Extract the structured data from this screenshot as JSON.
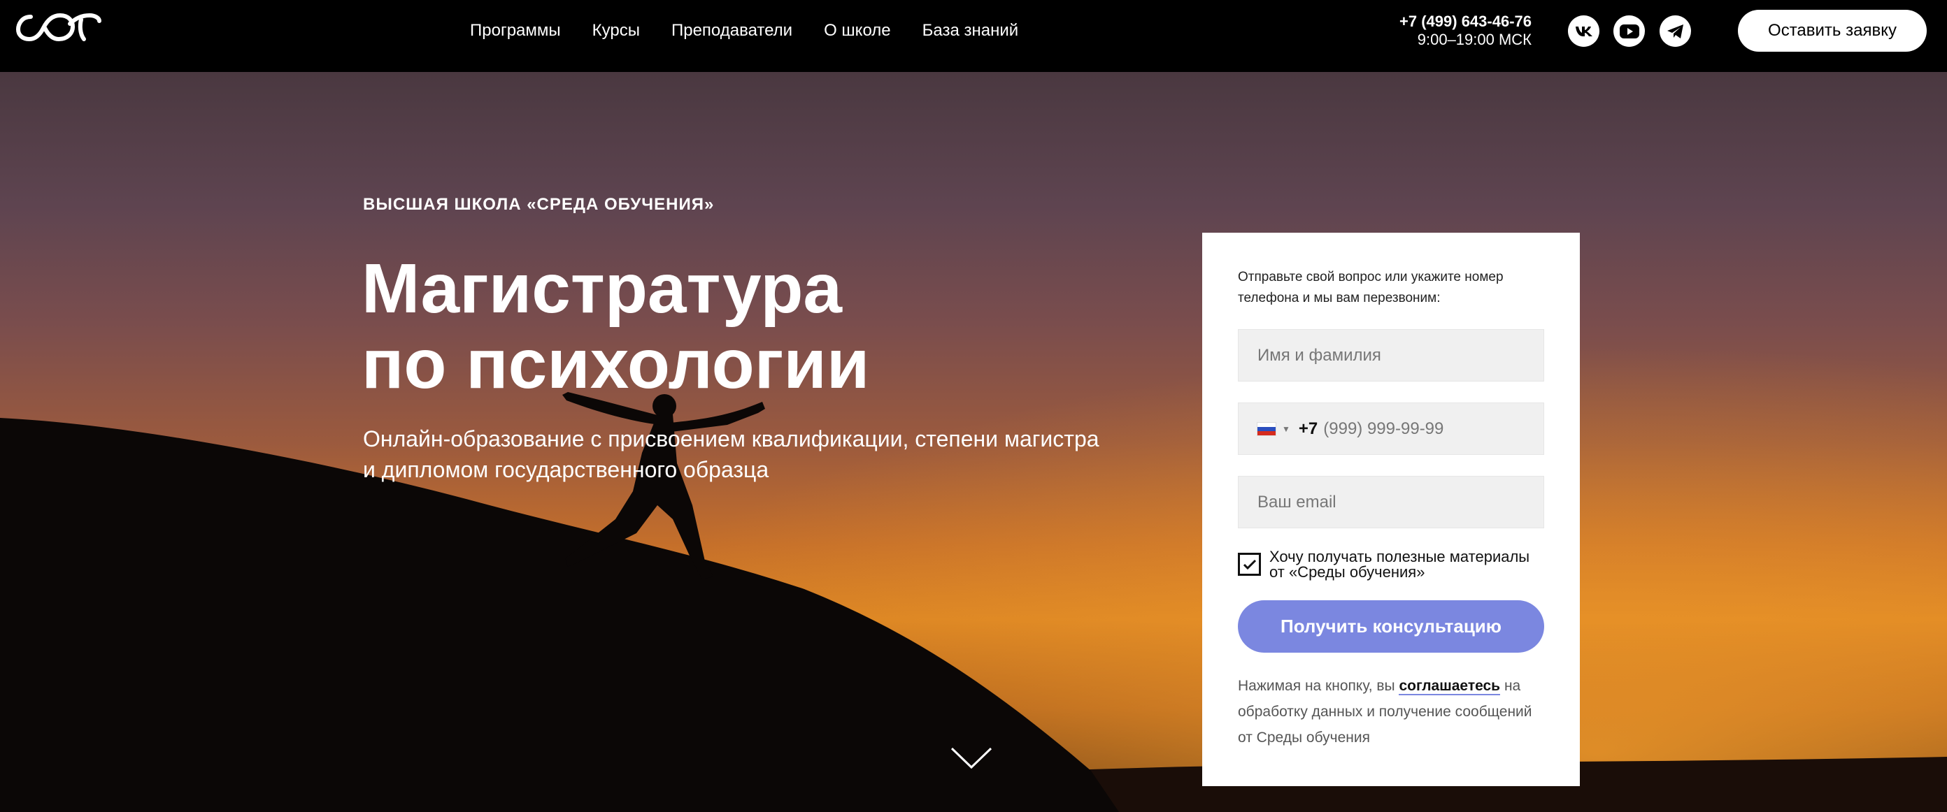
{
  "colors": {
    "header_bg": "#000000",
    "accent": "#7b87e0",
    "field_bg": "#f0f0f0"
  },
  "header": {
    "logo_icon": "infinity-logo-icon",
    "nav": [
      {
        "label": "Программы"
      },
      {
        "label": "Курсы"
      },
      {
        "label": "Преподаватели"
      },
      {
        "label": "О школе"
      },
      {
        "label": "База знаний"
      }
    ],
    "phone": "+7 (499) 643-46-76",
    "hours": "9:00–19:00 МСК",
    "social": [
      {
        "icon": "vk-icon"
      },
      {
        "icon": "youtube-icon"
      },
      {
        "icon": "telegram-icon"
      }
    ],
    "cta_label": "Оставить заявку"
  },
  "hero": {
    "eyebrow": "ВЫСШАЯ ШКОЛА «СРЕДА ОБУЧЕНИЯ»",
    "title_line1": "Магистратура",
    "title_line2": "по психологии",
    "subtitle": "Онлайн-образование с присвоением квалификации, степени магистра и дипломом государственного образца",
    "scroll_icon": "chevron-down-icon"
  },
  "form": {
    "intro": "Отправьте свой вопрос или укажите номер телефона и мы вам перезвоним:",
    "name_placeholder": "Имя и фамилия",
    "country_flag": "russia-flag-icon",
    "dial_code": "+7",
    "phone_placeholder": "(999) 999-99-99",
    "email_placeholder": "Ваш email",
    "subscribe_checked": true,
    "subscribe_label": "Хочу получать полезные материалы от «Среды обучения»",
    "submit_label": "Получить консультацию",
    "consent_prefix": "Нажимая на кнопку, вы",
    "consent_link": "соглашаетесь",
    "consent_suffix": "на обработку данных и получение сообщений от Среды обучения"
  }
}
